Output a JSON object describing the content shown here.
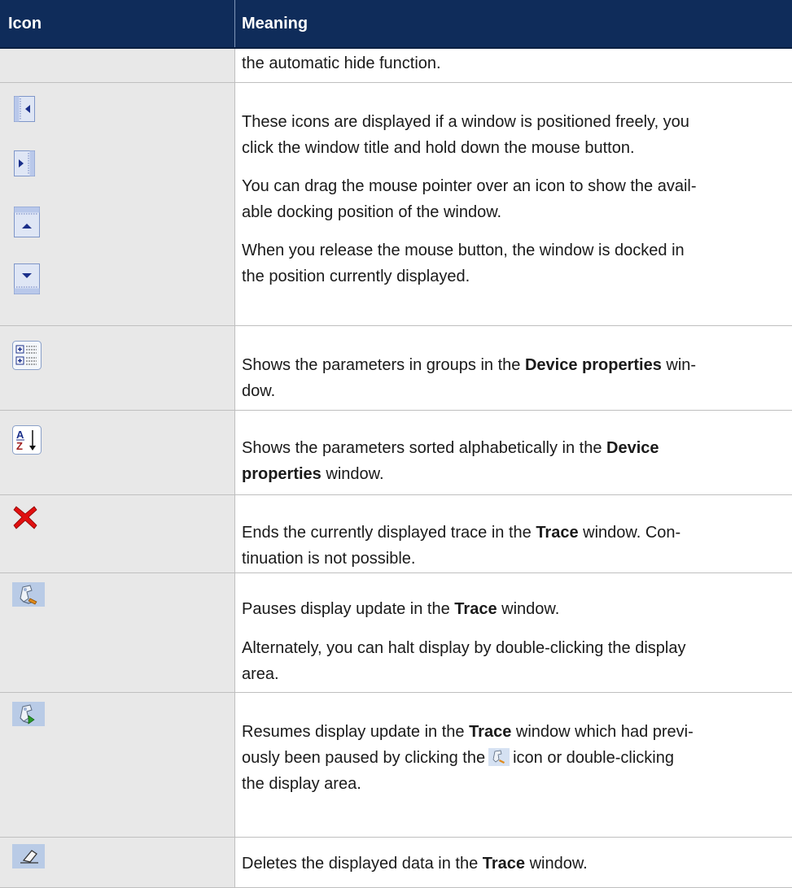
{
  "header": {
    "col_icon": "Icon",
    "col_meaning": "Meaning"
  },
  "rows": [
    {
      "p1": "the automatic hide function."
    },
    {
      "icons": [
        "dock-left-icon",
        "dock-right-icon",
        "dock-top-icon",
        "dock-bottom-icon"
      ],
      "p1_l1": "These icons are displayed if a window is positioned freely, you",
      "p1_l2": "click the window title and hold down the mouse button.",
      "p2_l1": "You can drag the mouse pointer over an icon to show the avail-",
      "p2_l2": "able docking position of the window.",
      "p3_l1": "When you release the mouse button, the window is docked in",
      "p3_l2": "the position currently displayed."
    },
    {
      "icons": [
        "grouped-view-icon"
      ],
      "l1_a": "Shows the parameters in groups in the ",
      "l1_b": "Device properties",
      "l1_c": " win-",
      "l2": "dow."
    },
    {
      "icons": [
        "sort-alphabetical-icon"
      ],
      "l1_a": "Shows the parameters sorted alphabetically in the ",
      "l1_b": "Device",
      "l2_a": "properties",
      "l2_b": " window."
    },
    {
      "icons": [
        "red-x-icon"
      ],
      "l1_a": "Ends the currently displayed trace in the ",
      "l1_b": "Trace",
      "l1_c": " window. Con-",
      "l2": "tinuation is not possible."
    },
    {
      "icons": [
        "trace-pause-icon"
      ],
      "l1_a": "Pauses display update in the ",
      "l1_b": "Trace",
      "l1_c": " window.",
      "p2_l1": "Alternately, you can halt display by double-clicking the display",
      "p2_l2": "area."
    },
    {
      "icons": [
        "trace-resume-icon"
      ],
      "l1_a": "Resumes display update in the ",
      "l1_b": "Trace",
      "l1_c": " window which had previ-",
      "l2_a": "ously been paused by clicking the",
      "l2_b": "icon or double-clicking",
      "l3": "the display area."
    },
    {
      "icons": [
        "eraser-icon"
      ],
      "l1_a": "Deletes the displayed data in the ",
      "l1_b": "Trace",
      "l1_c": " window."
    }
  ],
  "colors": {
    "header_bg": "#0f2c5a",
    "icon_cell_bg": "#e8e8e8",
    "rule": "#bfbfbf",
    "x_red": "#e01010"
  }
}
